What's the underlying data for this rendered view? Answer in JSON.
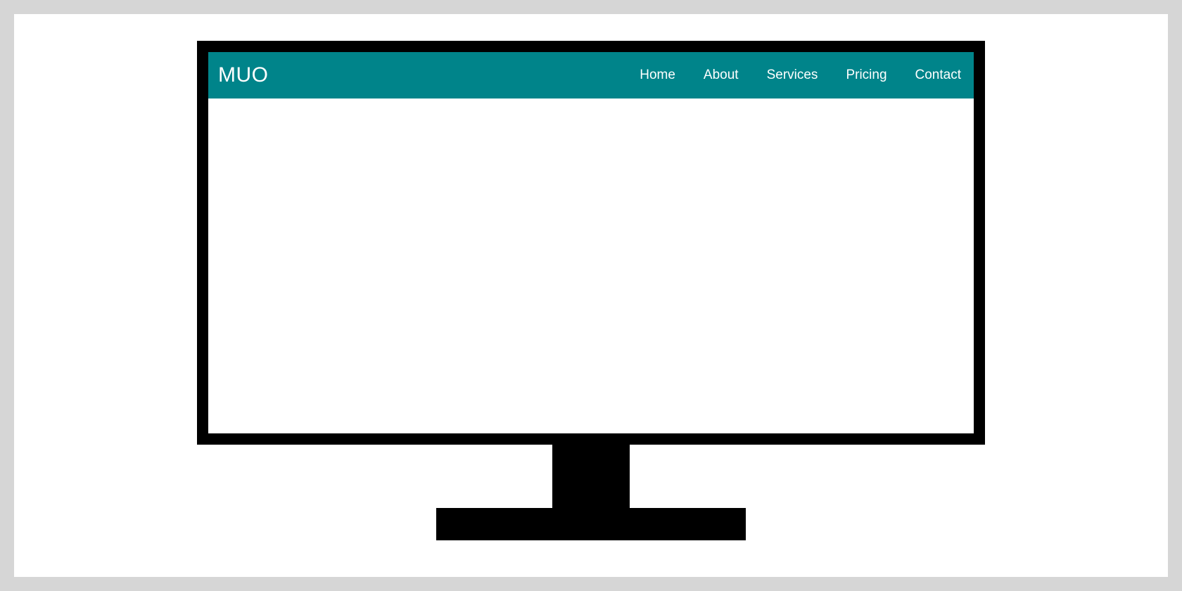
{
  "colors": {
    "navbar_bg": "#00848a",
    "navbar_text": "#ffffff",
    "page_bg": "#d6d6d6",
    "canvas_bg": "#ffffff",
    "monitor_frame": "#000000"
  },
  "logo": "MUO",
  "nav": {
    "items": [
      {
        "label": "Home"
      },
      {
        "label": "About"
      },
      {
        "label": "Services"
      },
      {
        "label": "Pricing"
      },
      {
        "label": "Contact"
      }
    ]
  }
}
